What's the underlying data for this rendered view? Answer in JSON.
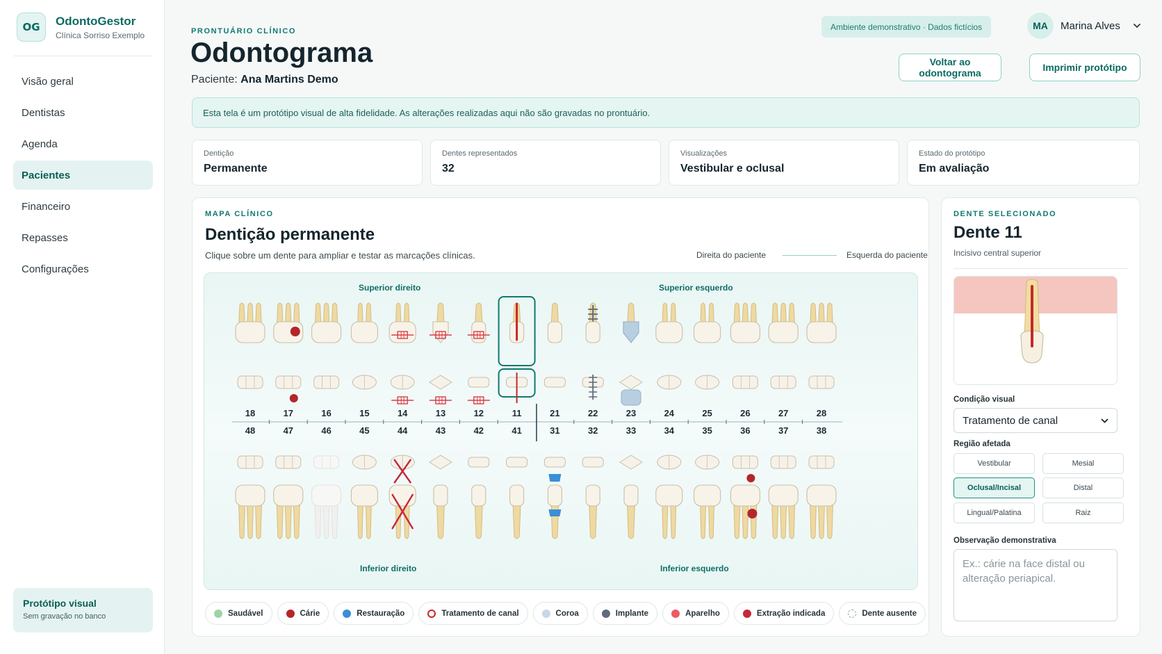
{
  "brand": {
    "initials": "OG",
    "name": "OdontoGestor",
    "clinic": "Clínica Sorriso Exemplo"
  },
  "nav": [
    {
      "label": "Visão geral",
      "active": false
    },
    {
      "label": "Dentistas",
      "active": false
    },
    {
      "label": "Agenda",
      "active": false
    },
    {
      "label": "Pacientes",
      "active": true
    },
    {
      "label": "Financeiro",
      "active": false
    },
    {
      "label": "Repasses",
      "active": false
    },
    {
      "label": "Configurações",
      "active": false
    }
  ],
  "sidebar_footer": {
    "title": "Protótipo visual",
    "subtitle": "Sem gravação no banco"
  },
  "header": {
    "eyebrow": "PRONTUÁRIO CLÍNICO",
    "title": "Odontograma",
    "patient_label": "Paciente:",
    "patient_name": "Ana Martins Demo",
    "demo_badge": "Ambiente demonstrativo · Dados fictícios",
    "user_initials": "MA",
    "user_name": "Marina Alves",
    "back_button": "Voltar ao odontograma",
    "print_button": "Imprimir protótipo"
  },
  "notice": "Esta tela é um protótipo visual de alta fidelidade. As alterações realizadas aqui não são gravadas no prontuário.",
  "stats": [
    {
      "label": "Dentição",
      "value": "Permanente"
    },
    {
      "label": "Dentes representados",
      "value": "32"
    },
    {
      "label": "Visualizações",
      "value": "Vestibular e oclusal"
    },
    {
      "label": "Estado do protótipo",
      "value": "Em avaliação"
    }
  ],
  "map": {
    "eyebrow": "MAPA CLÍNICO",
    "title": "Dentição permanente",
    "subtitle": "Clique sobre um dente para ampliar e testar as marcações clínicas.",
    "patient_right": "Direita do paciente",
    "patient_left": "Esquerda do paciente",
    "quadrants": {
      "upper_right": "Superior direito",
      "upper_left": "Superior esquerdo",
      "lower_right": "Inferior direito",
      "lower_left": "Inferior esquerdo"
    },
    "upper_teeth": [
      {
        "n": "18",
        "type": "molar",
        "cond": "healthy"
      },
      {
        "n": "17",
        "type": "molar",
        "cond": "caries"
      },
      {
        "n": "16",
        "type": "molar",
        "cond": "healthy"
      },
      {
        "n": "15",
        "type": "premolar",
        "cond": "healthy"
      },
      {
        "n": "14",
        "type": "premolar",
        "cond": "braces"
      },
      {
        "n": "13",
        "type": "canine",
        "cond": "braces"
      },
      {
        "n": "12",
        "type": "incisor",
        "cond": "braces"
      },
      {
        "n": "11",
        "type": "incisor",
        "cond": "canal",
        "selected": true
      },
      {
        "n": "21",
        "type": "incisor",
        "cond": "healthy"
      },
      {
        "n": "22",
        "type": "incisor",
        "cond": "implant"
      },
      {
        "n": "23",
        "type": "canine",
        "cond": "crown"
      },
      {
        "n": "24",
        "type": "premolar",
        "cond": "healthy"
      },
      {
        "n": "25",
        "type": "premolar",
        "cond": "healthy"
      },
      {
        "n": "26",
        "type": "molar",
        "cond": "healthy"
      },
      {
        "n": "27",
        "type": "molar",
        "cond": "healthy"
      },
      {
        "n": "28",
        "type": "molar",
        "cond": "healthy"
      }
    ],
    "lower_teeth": [
      {
        "n": "48",
        "type": "molar",
        "cond": "healthy"
      },
      {
        "n": "47",
        "type": "molar",
        "cond": "healthy"
      },
      {
        "n": "46",
        "type": "molar",
        "cond": "absent"
      },
      {
        "n": "45",
        "type": "premolar",
        "cond": "healthy"
      },
      {
        "n": "44",
        "type": "premolar",
        "cond": "extraction"
      },
      {
        "n": "43",
        "type": "canine",
        "cond": "healthy"
      },
      {
        "n": "42",
        "type": "incisor",
        "cond": "healthy"
      },
      {
        "n": "41",
        "type": "incisor",
        "cond": "healthy"
      },
      {
        "n": "31",
        "type": "incisor",
        "cond": "restoration"
      },
      {
        "n": "32",
        "type": "incisor",
        "cond": "healthy"
      },
      {
        "n": "33",
        "type": "canine",
        "cond": "healthy"
      },
      {
        "n": "34",
        "type": "premolar",
        "cond": "healthy"
      },
      {
        "n": "35",
        "type": "premolar",
        "cond": "healthy"
      },
      {
        "n": "36",
        "type": "molar",
        "cond": "caries"
      },
      {
        "n": "37",
        "type": "molar",
        "cond": "healthy"
      },
      {
        "n": "38",
        "type": "molar",
        "cond": "healthy"
      }
    ]
  },
  "legend": [
    {
      "label": "Saudável",
      "color": "#9dd3a8",
      "style": "fill"
    },
    {
      "label": "Cárie",
      "color": "#b3262a",
      "style": "fill"
    },
    {
      "label": "Restauração",
      "color": "#3a8fd6",
      "style": "fill"
    },
    {
      "label": "Tratamento de canal",
      "color": "#c62828",
      "style": "ring"
    },
    {
      "label": "Coroa",
      "color": "#c8d7e6",
      "style": "fill"
    },
    {
      "label": "Implante",
      "color": "#5f6b78",
      "style": "fill"
    },
    {
      "label": "Aparelho",
      "color": "#ef5b64",
      "style": "fill"
    },
    {
      "label": "Extração indicada",
      "color": "#c6283a",
      "style": "fill"
    },
    {
      "label": "Dente ausente",
      "color": "#9aa4a8",
      "style": "dashed"
    }
  ],
  "selected": {
    "eyebrow": "DENTE SELECIONADO",
    "title": "Dente 11",
    "subtitle": "Incisivo central superior",
    "condition_label": "Condição visual",
    "condition_value": "Tratamento de canal",
    "region_label": "Região afetada",
    "regions": [
      {
        "label": "Vestibular",
        "active": false
      },
      {
        "label": "Mesial",
        "active": false
      },
      {
        "label": "Oclusal/Incisal",
        "active": true
      },
      {
        "label": "Distal",
        "active": false
      },
      {
        "label": "Lingual/Palatina",
        "active": false
      },
      {
        "label": "Raiz",
        "active": false
      }
    ],
    "note_label": "Observação demonstrativa",
    "note_placeholder": "Ex.: cárie na face distal ou alteração periapical."
  }
}
